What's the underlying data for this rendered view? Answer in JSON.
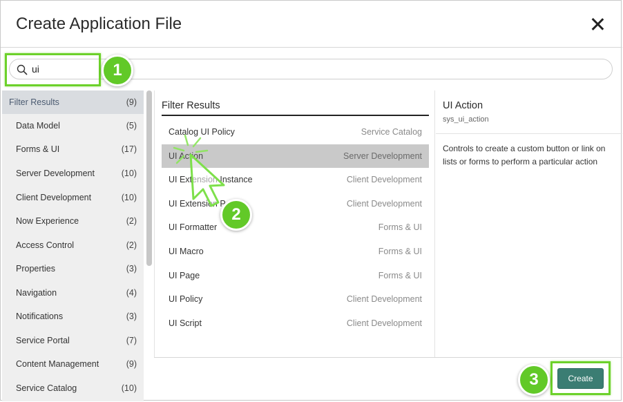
{
  "dialog": {
    "title": "Create Application File"
  },
  "search": {
    "value": "ui"
  },
  "sidebar": {
    "items": [
      {
        "label": "Filter Results",
        "count": "(9)"
      },
      {
        "label": "Data Model",
        "count": "(5)"
      },
      {
        "label": "Forms & UI",
        "count": "(17)"
      },
      {
        "label": "Server Development",
        "count": "(10)"
      },
      {
        "label": "Client Development",
        "count": "(10)"
      },
      {
        "label": "Now Experience",
        "count": "(2)"
      },
      {
        "label": "Access Control",
        "count": "(2)"
      },
      {
        "label": "Properties",
        "count": "(3)"
      },
      {
        "label": "Navigation",
        "count": "(4)"
      },
      {
        "label": "Notifications",
        "count": "(3)"
      },
      {
        "label": "Service Portal",
        "count": "(7)"
      },
      {
        "label": "Content Management",
        "count": "(9)"
      },
      {
        "label": "Service Catalog",
        "count": "(10)"
      }
    ]
  },
  "results": {
    "heading": "Filter Results",
    "rows": [
      {
        "name": "Catalog UI Policy",
        "category": "Service Catalog"
      },
      {
        "name": "UI Action",
        "category": "Server Development"
      },
      {
        "name": "UI Extension Instance",
        "category": "Client Development"
      },
      {
        "name": "UI Extension Point",
        "category": "Client Development"
      },
      {
        "name": "UI Formatter",
        "category": "Forms & UI"
      },
      {
        "name": "UI Macro",
        "category": "Forms & UI"
      },
      {
        "name": "UI Page",
        "category": "Forms & UI"
      },
      {
        "name": "UI Policy",
        "category": "Client Development"
      },
      {
        "name": "UI Script",
        "category": "Client Development"
      }
    ]
  },
  "detail": {
    "title": "UI Action",
    "table_name": "sys_ui_action",
    "description": "Controls to create a custom button or link on lists or forms to perform a particular action"
  },
  "footer": {
    "create_label": "Create"
  },
  "callouts": {
    "step1": "1",
    "step2": "2",
    "step3": "3",
    "color": "#62c928"
  }
}
